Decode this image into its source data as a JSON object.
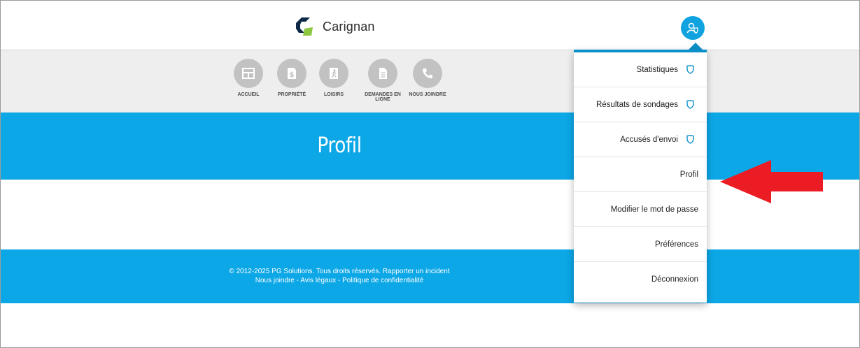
{
  "header": {
    "brand_name": "Carignan",
    "logo_icon": "carignan-logo-icon",
    "user_icon": "user-account-icon"
  },
  "nav": {
    "items": [
      {
        "label": "ACCUEIL",
        "icon": "home-icon"
      },
      {
        "label": "PROPRIÉTÉ",
        "icon": "property-tax-icon"
      },
      {
        "label": "LOISIRS",
        "icon": "leisure-icon"
      },
      {
        "label": "DEMANDES EN\nLIGNE",
        "line1": "DEMANDES EN",
        "line2": "LIGNE",
        "icon": "document-icon"
      },
      {
        "label": "NOUS JOINDRE",
        "icon": "phone-icon"
      }
    ]
  },
  "banner": {
    "title": "Profil"
  },
  "footer": {
    "line1_copyright": "© 2012-2025 PG Solutions. Tous droits réservés.",
    "line1_link": "Rapporter un incident",
    "line2_contact": "Nous joindre",
    "sep": " - ",
    "line2_legal": "Avis légaux",
    "line2_privacy": "Politique de confidentialité"
  },
  "dropdown": {
    "items": [
      {
        "label": "Statistiques",
        "icon": "shield-icon"
      },
      {
        "label": "Résultats de sondages",
        "icon": "shield-icon"
      },
      {
        "label": "Accusés d'envoi",
        "icon": "shield-icon"
      },
      {
        "label": "Profil"
      },
      {
        "label": "Modifier le mot de passe"
      },
      {
        "label": "Préférences"
      },
      {
        "label": "Déconnexion"
      }
    ]
  },
  "annotation": {
    "icon": "red-arrow-icon",
    "color": "#ec1c24"
  },
  "colors": {
    "accent_blue": "#0ca7e6",
    "dropdown_border": "#0c90c9",
    "nav_circle": "#c2c2c2",
    "nav_band": "#eeeeee"
  }
}
